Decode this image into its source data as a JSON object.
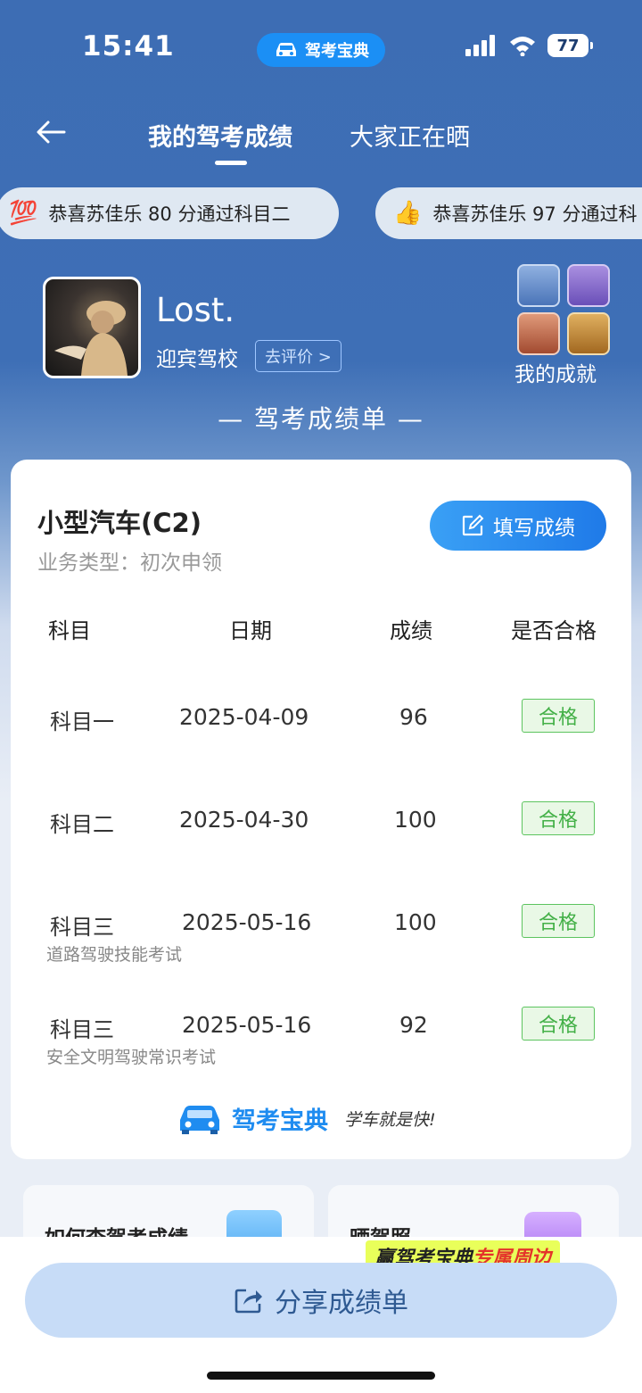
{
  "status_bar": {
    "time": "15:41",
    "app_pill": "驾考宝典",
    "battery": "77"
  },
  "nav": {
    "tab_active": "我的驾考成绩",
    "tab_other": "大家正在晒"
  },
  "congrats": [
    {
      "emoji": "💯",
      "text": "恭喜苏佳乐 80 分通过科目二"
    },
    {
      "emoji": "👍",
      "text": "恭喜苏佳乐 97 分通过科"
    }
  ],
  "profile": {
    "name": "Lost.",
    "school": "迎宾驾校",
    "rate_label": "去评价 >",
    "achievements_label": "我的成就"
  },
  "sheet_title": "— 驾考成绩单 —",
  "card": {
    "license": "小型汽车(C2)",
    "business_type": "业务类型：初次申领",
    "fill_button": "填写成绩",
    "headers": [
      "科目",
      "日期",
      "成绩",
      "是否合格"
    ],
    "rows": [
      {
        "subject": "科目一",
        "sub": "",
        "date": "2025-04-09",
        "score": "96",
        "status": "合格"
      },
      {
        "subject": "科目二",
        "sub": "",
        "date": "2025-04-30",
        "score": "100",
        "status": "合格"
      },
      {
        "subject": "科目三",
        "sub": "道路驾驶技能考试",
        "date": "2025-05-16",
        "score": "100",
        "status": "合格"
      },
      {
        "subject": "科目三",
        "sub": "安全文明驾驶常识考试",
        "date": "2025-05-16",
        "score": "92",
        "status": "合格"
      }
    ],
    "brand_name": "驾考宝典",
    "brand_slogan": "学车就是快!"
  },
  "bottom_cards": [
    {
      "title": "如何查驾考成绩"
    },
    {
      "title": "晒驾照"
    }
  ],
  "promo": {
    "part1": "赢驾考宝典",
    "part2": "专属周边"
  },
  "share_button": "分享成绩单",
  "colors": {
    "header_blue": "#3d6db4",
    "accent_blue": "#1f8cf0",
    "pass_green": "#43b047"
  }
}
